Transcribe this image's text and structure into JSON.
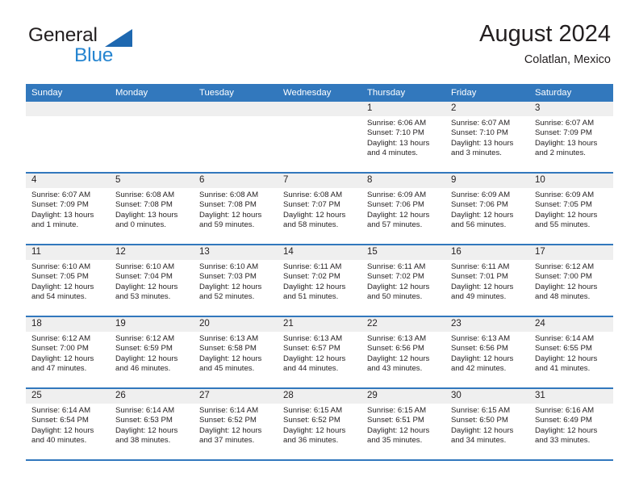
{
  "brand": {
    "name_part1": "General",
    "name_part2": "Blue",
    "triangle_color": "#1e68b0",
    "blue_color": "#2685d0"
  },
  "header": {
    "title": "August 2024",
    "subtitle": "Colatlan, Mexico"
  },
  "theme": {
    "header_row_bg": "#3278bd",
    "daynum_band_bg": "#efefef",
    "text_color": "#231f20",
    "row_divider": "#3278bd"
  },
  "weekdays": [
    "Sunday",
    "Monday",
    "Tuesday",
    "Wednesday",
    "Thursday",
    "Friday",
    "Saturday"
  ],
  "weeks": [
    [
      {
        "day": "",
        "sunrise": "",
        "sunset": "",
        "daylight_line1": "",
        "daylight_line2": ""
      },
      {
        "day": "",
        "sunrise": "",
        "sunset": "",
        "daylight_line1": "",
        "daylight_line2": ""
      },
      {
        "day": "",
        "sunrise": "",
        "sunset": "",
        "daylight_line1": "",
        "daylight_line2": ""
      },
      {
        "day": "",
        "sunrise": "",
        "sunset": "",
        "daylight_line1": "",
        "daylight_line2": ""
      },
      {
        "day": "1",
        "sunrise": "Sunrise: 6:06 AM",
        "sunset": "Sunset: 7:10 PM",
        "daylight_line1": "Daylight: 13 hours",
        "daylight_line2": "and 4 minutes."
      },
      {
        "day": "2",
        "sunrise": "Sunrise: 6:07 AM",
        "sunset": "Sunset: 7:10 PM",
        "daylight_line1": "Daylight: 13 hours",
        "daylight_line2": "and 3 minutes."
      },
      {
        "day": "3",
        "sunrise": "Sunrise: 6:07 AM",
        "sunset": "Sunset: 7:09 PM",
        "daylight_line1": "Daylight: 13 hours",
        "daylight_line2": "and 2 minutes."
      }
    ],
    [
      {
        "day": "4",
        "sunrise": "Sunrise: 6:07 AM",
        "sunset": "Sunset: 7:09 PM",
        "daylight_line1": "Daylight: 13 hours",
        "daylight_line2": "and 1 minute."
      },
      {
        "day": "5",
        "sunrise": "Sunrise: 6:08 AM",
        "sunset": "Sunset: 7:08 PM",
        "daylight_line1": "Daylight: 13 hours",
        "daylight_line2": "and 0 minutes."
      },
      {
        "day": "6",
        "sunrise": "Sunrise: 6:08 AM",
        "sunset": "Sunset: 7:08 PM",
        "daylight_line1": "Daylight: 12 hours",
        "daylight_line2": "and 59 minutes."
      },
      {
        "day": "7",
        "sunrise": "Sunrise: 6:08 AM",
        "sunset": "Sunset: 7:07 PM",
        "daylight_line1": "Daylight: 12 hours",
        "daylight_line2": "and 58 minutes."
      },
      {
        "day": "8",
        "sunrise": "Sunrise: 6:09 AM",
        "sunset": "Sunset: 7:06 PM",
        "daylight_line1": "Daylight: 12 hours",
        "daylight_line2": "and 57 minutes."
      },
      {
        "day": "9",
        "sunrise": "Sunrise: 6:09 AM",
        "sunset": "Sunset: 7:06 PM",
        "daylight_line1": "Daylight: 12 hours",
        "daylight_line2": "and 56 minutes."
      },
      {
        "day": "10",
        "sunrise": "Sunrise: 6:09 AM",
        "sunset": "Sunset: 7:05 PM",
        "daylight_line1": "Daylight: 12 hours",
        "daylight_line2": "and 55 minutes."
      }
    ],
    [
      {
        "day": "11",
        "sunrise": "Sunrise: 6:10 AM",
        "sunset": "Sunset: 7:05 PM",
        "daylight_line1": "Daylight: 12 hours",
        "daylight_line2": "and 54 minutes."
      },
      {
        "day": "12",
        "sunrise": "Sunrise: 6:10 AM",
        "sunset": "Sunset: 7:04 PM",
        "daylight_line1": "Daylight: 12 hours",
        "daylight_line2": "and 53 minutes."
      },
      {
        "day": "13",
        "sunrise": "Sunrise: 6:10 AM",
        "sunset": "Sunset: 7:03 PM",
        "daylight_line1": "Daylight: 12 hours",
        "daylight_line2": "and 52 minutes."
      },
      {
        "day": "14",
        "sunrise": "Sunrise: 6:11 AM",
        "sunset": "Sunset: 7:02 PM",
        "daylight_line1": "Daylight: 12 hours",
        "daylight_line2": "and 51 minutes."
      },
      {
        "day": "15",
        "sunrise": "Sunrise: 6:11 AM",
        "sunset": "Sunset: 7:02 PM",
        "daylight_line1": "Daylight: 12 hours",
        "daylight_line2": "and 50 minutes."
      },
      {
        "day": "16",
        "sunrise": "Sunrise: 6:11 AM",
        "sunset": "Sunset: 7:01 PM",
        "daylight_line1": "Daylight: 12 hours",
        "daylight_line2": "and 49 minutes."
      },
      {
        "day": "17",
        "sunrise": "Sunrise: 6:12 AM",
        "sunset": "Sunset: 7:00 PM",
        "daylight_line1": "Daylight: 12 hours",
        "daylight_line2": "and 48 minutes."
      }
    ],
    [
      {
        "day": "18",
        "sunrise": "Sunrise: 6:12 AM",
        "sunset": "Sunset: 7:00 PM",
        "daylight_line1": "Daylight: 12 hours",
        "daylight_line2": "and 47 minutes."
      },
      {
        "day": "19",
        "sunrise": "Sunrise: 6:12 AM",
        "sunset": "Sunset: 6:59 PM",
        "daylight_line1": "Daylight: 12 hours",
        "daylight_line2": "and 46 minutes."
      },
      {
        "day": "20",
        "sunrise": "Sunrise: 6:13 AM",
        "sunset": "Sunset: 6:58 PM",
        "daylight_line1": "Daylight: 12 hours",
        "daylight_line2": "and 45 minutes."
      },
      {
        "day": "21",
        "sunrise": "Sunrise: 6:13 AM",
        "sunset": "Sunset: 6:57 PM",
        "daylight_line1": "Daylight: 12 hours",
        "daylight_line2": "and 44 minutes."
      },
      {
        "day": "22",
        "sunrise": "Sunrise: 6:13 AM",
        "sunset": "Sunset: 6:56 PM",
        "daylight_line1": "Daylight: 12 hours",
        "daylight_line2": "and 43 minutes."
      },
      {
        "day": "23",
        "sunrise": "Sunrise: 6:13 AM",
        "sunset": "Sunset: 6:56 PM",
        "daylight_line1": "Daylight: 12 hours",
        "daylight_line2": "and 42 minutes."
      },
      {
        "day": "24",
        "sunrise": "Sunrise: 6:14 AM",
        "sunset": "Sunset: 6:55 PM",
        "daylight_line1": "Daylight: 12 hours",
        "daylight_line2": "and 41 minutes."
      }
    ],
    [
      {
        "day": "25",
        "sunrise": "Sunrise: 6:14 AM",
        "sunset": "Sunset: 6:54 PM",
        "daylight_line1": "Daylight: 12 hours",
        "daylight_line2": "and 40 minutes."
      },
      {
        "day": "26",
        "sunrise": "Sunrise: 6:14 AM",
        "sunset": "Sunset: 6:53 PM",
        "daylight_line1": "Daylight: 12 hours",
        "daylight_line2": "and 38 minutes."
      },
      {
        "day": "27",
        "sunrise": "Sunrise: 6:14 AM",
        "sunset": "Sunset: 6:52 PM",
        "daylight_line1": "Daylight: 12 hours",
        "daylight_line2": "and 37 minutes."
      },
      {
        "day": "28",
        "sunrise": "Sunrise: 6:15 AM",
        "sunset": "Sunset: 6:52 PM",
        "daylight_line1": "Daylight: 12 hours",
        "daylight_line2": "and 36 minutes."
      },
      {
        "day": "29",
        "sunrise": "Sunrise: 6:15 AM",
        "sunset": "Sunset: 6:51 PM",
        "daylight_line1": "Daylight: 12 hours",
        "daylight_line2": "and 35 minutes."
      },
      {
        "day": "30",
        "sunrise": "Sunrise: 6:15 AM",
        "sunset": "Sunset: 6:50 PM",
        "daylight_line1": "Daylight: 12 hours",
        "daylight_line2": "and 34 minutes."
      },
      {
        "day": "31",
        "sunrise": "Sunrise: 6:16 AM",
        "sunset": "Sunset: 6:49 PM",
        "daylight_line1": "Daylight: 12 hours",
        "daylight_line2": "and 33 minutes."
      }
    ]
  ]
}
